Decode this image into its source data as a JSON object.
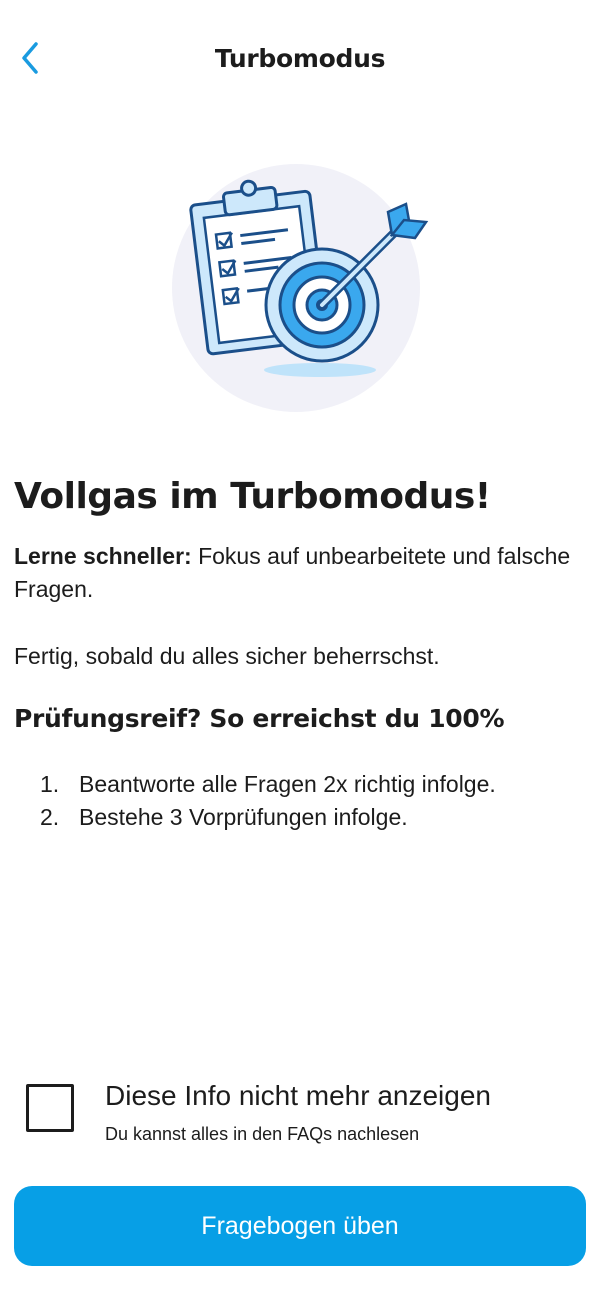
{
  "header": {
    "title": "Turbomodus",
    "back_icon": "chevron-left-icon"
  },
  "illustration": {
    "icon": "clipboard-target-illustration",
    "colors": {
      "light": "#cde8fb",
      "accent": "#3aa8ee",
      "stroke": "#1b4f8a",
      "circle_bg": "#f1f1f8"
    }
  },
  "content": {
    "headline": "Vollgas im Turbomodus!",
    "intro_bold": "Lerne schneller:",
    "intro_rest": " Fokus auf unbearbeitete und falsche Fragen.",
    "finish_text": "Fertig, sobald du alles sicher beherrschst.",
    "subheading": "Prüfungsreif? So erreichst du 100%",
    "steps": [
      {
        "num": "1.",
        "text": "Beantworte alle Fragen 2x richtig infolge."
      },
      {
        "num": "2.",
        "text": "Bestehe 3 Vorprüfungen infolge."
      }
    ]
  },
  "checkbox": {
    "label": "Diese Info nicht mehr anzeigen",
    "sublabel": "Du kannst alles in den FAQs nachlesen",
    "checked": false
  },
  "primary_button": {
    "label": "Fragebogen üben",
    "color": "#079fe6"
  },
  "colors": {
    "accent": "#079fe6",
    "back_icon": "#1a9be0",
    "text": "#1c1c1c"
  }
}
